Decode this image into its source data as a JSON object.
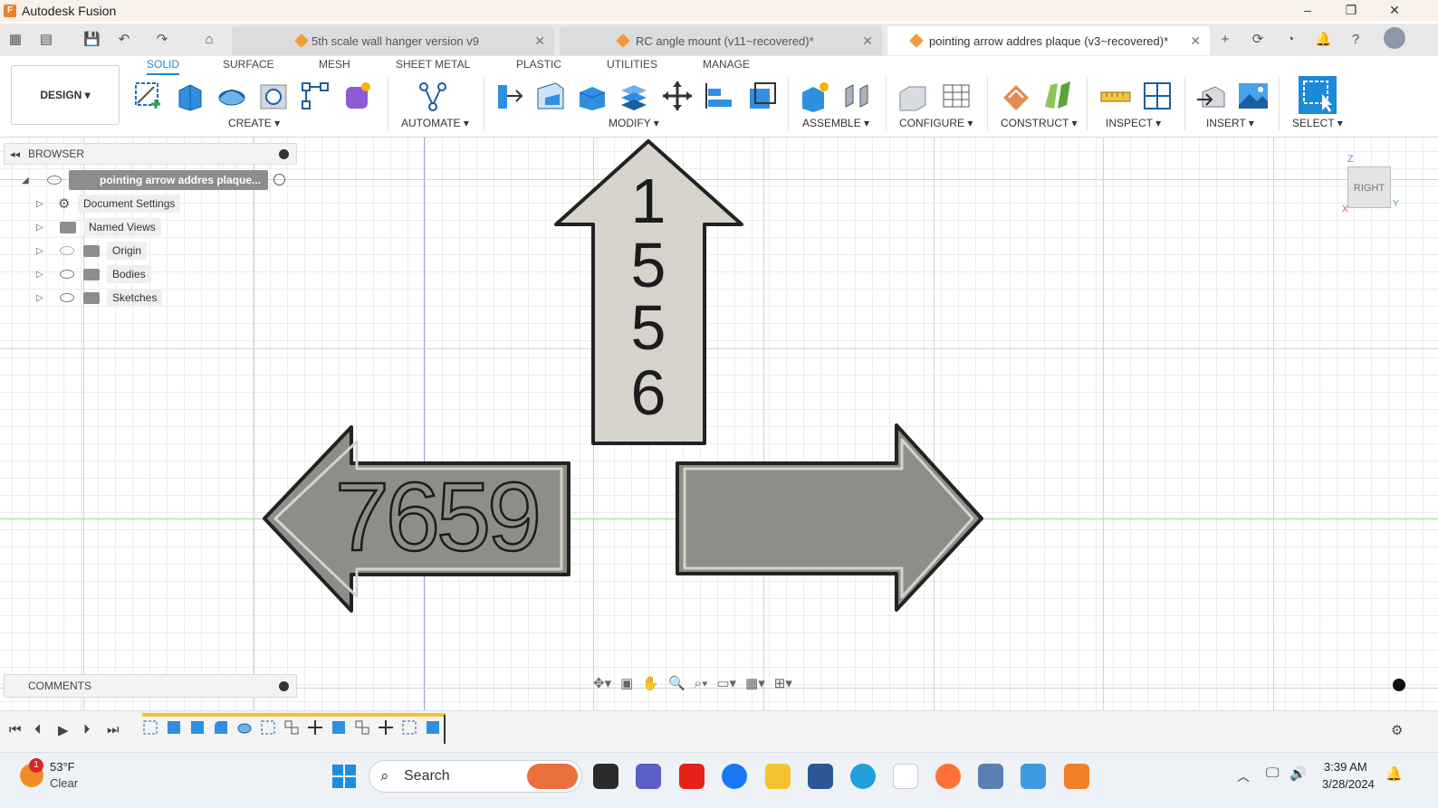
{
  "window": {
    "app_title": "Autodesk Fusion"
  },
  "tabs": [
    {
      "label": "5th scale wall hanger  version v9"
    },
    {
      "label": "RC angle mount (v11~recovered)*"
    },
    {
      "label": "pointing arrow addres  plaque (v3~recovered)*"
    }
  ],
  "workspace": {
    "label": "DESIGN"
  },
  "ribbon_tabs": [
    "SOLID",
    "SURFACE",
    "MESH",
    "SHEET METAL",
    "PLASTIC",
    "UTILITIES",
    "MANAGE"
  ],
  "ribbon_groups": [
    "CREATE",
    "AUTOMATE",
    "MODIFY",
    "ASSEMBLE",
    "CONFIGURE",
    "CONSTRUCT",
    "INSPECT",
    "INSERT",
    "SELECT"
  ],
  "browser": {
    "title": "BROWSER",
    "root": "pointing arrow addres  plaque...",
    "items": [
      "Document Settings",
      "Named Views",
      "Origin",
      "Bodies",
      "Sketches"
    ]
  },
  "comments": {
    "title": "COMMENTS"
  },
  "viewcube": {
    "face": "RIGHT",
    "axis_z": "Z",
    "axis_x": "X",
    "axis_y": "Y"
  },
  "model": {
    "up_arrow_text": [
      "1",
      "5",
      "5",
      "6"
    ],
    "left_arrow_text": "7659"
  },
  "taskbar": {
    "weather_temp": "53°F",
    "weather_desc": "Clear",
    "weather_badge": "1",
    "search_placeholder": "Search",
    "time": "3:39 AM",
    "date": "3/28/2024"
  },
  "colors": {
    "accent": "#1b8ad9",
    "plaque_light": "#d6d3cb",
    "plaque_dark": "#8e8d88"
  }
}
